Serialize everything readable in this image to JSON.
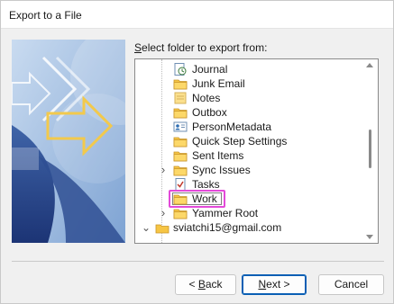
{
  "dialog": {
    "title": "Export to a File",
    "prompt_prefix": "",
    "prompt_accel": "S",
    "prompt_rest": "elect folder to export from:"
  },
  "tree": {
    "items": [
      {
        "label": "Journal",
        "icon": "journal-icon",
        "expandable": false
      },
      {
        "label": "Junk Email",
        "icon": "folder-icon",
        "expandable": false
      },
      {
        "label": "Notes",
        "icon": "notes-icon",
        "expandable": false
      },
      {
        "label": "Outbox",
        "icon": "folder-icon",
        "expandable": false
      },
      {
        "label": "PersonMetadata",
        "icon": "contact-card-icon",
        "expandable": false
      },
      {
        "label": "Quick Step Settings",
        "icon": "folder-icon",
        "expandable": false
      },
      {
        "label": "Sent Items",
        "icon": "folder-icon",
        "expandable": false
      },
      {
        "label": "Sync Issues",
        "icon": "folder-icon",
        "expandable": true
      },
      {
        "label": "Tasks",
        "icon": "tasks-icon",
        "expandable": false
      },
      {
        "label": "Work",
        "icon": "folder-icon",
        "expandable": false,
        "selected": true
      },
      {
        "label": "Yammer Root",
        "icon": "folder-icon",
        "expandable": true
      },
      {
        "label": "sviatchi15@gmail.com",
        "icon": "mailbox-icon",
        "expandable": true,
        "expanded": true
      }
    ]
  },
  "buttons": {
    "back_prefix": "< ",
    "back_accel": "B",
    "back_rest": "ack",
    "next_accel": "N",
    "next_rest": "ext >",
    "cancel": "Cancel"
  },
  "colors": {
    "selection_highlight": "#e34ad9",
    "folder_yellow": "#f6c544",
    "default_button_border": "#0a5fb4"
  }
}
